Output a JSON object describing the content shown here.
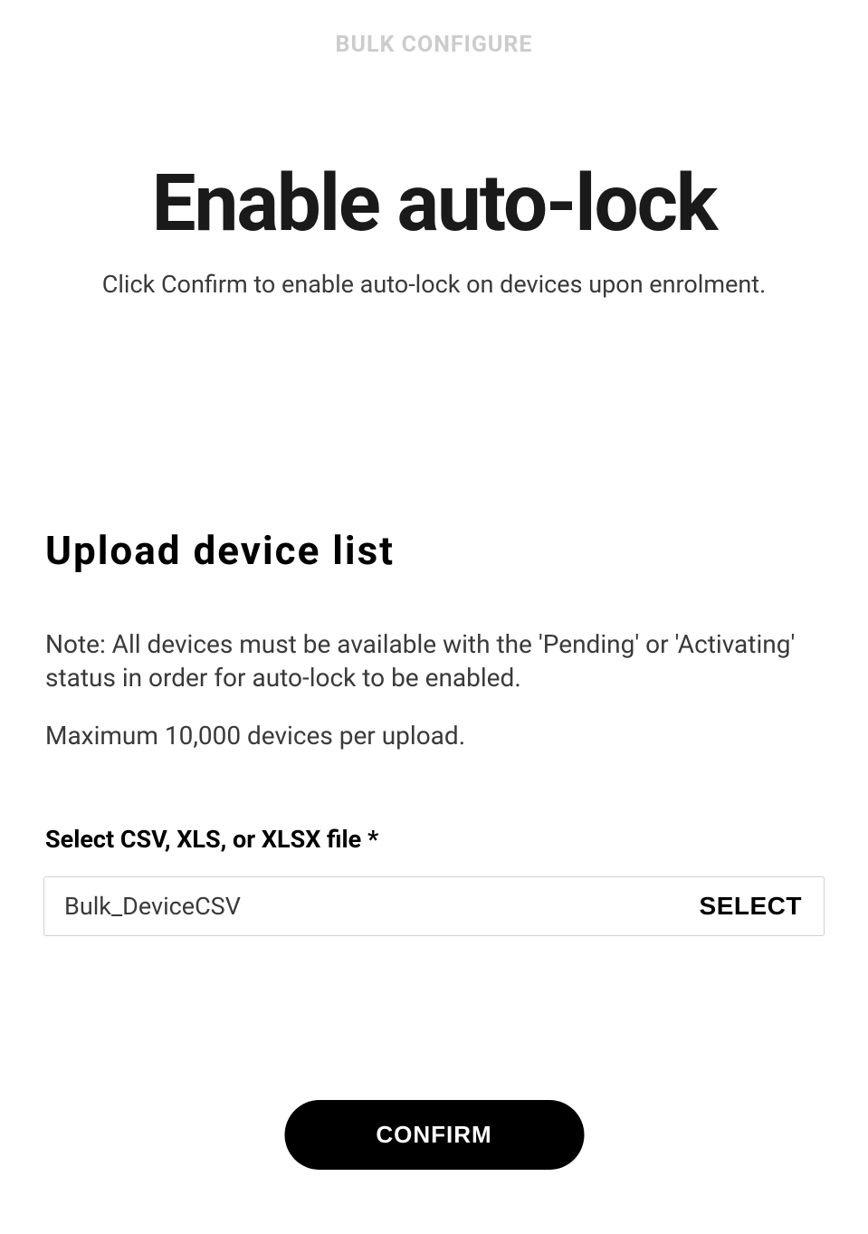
{
  "header": {
    "label": "BULK CONFIGURE"
  },
  "page": {
    "title": "Enable auto-lock",
    "subtitle": "Click Confirm to enable auto-lock on devices upon enrolment."
  },
  "upload": {
    "sectionTitle": "Upload device list",
    "note": "Note: All devices must be available with the 'Pending' or 'Activating' status in order for auto-lock to be enabled.",
    "maxNote": "Maximum 10,000 devices per upload.",
    "fileLabel": "Select CSV, XLS, or XLSX file *",
    "fileName": "Bulk_DeviceCSV",
    "selectButton": "SELECT"
  },
  "actions": {
    "confirm": "CONFIRM"
  }
}
